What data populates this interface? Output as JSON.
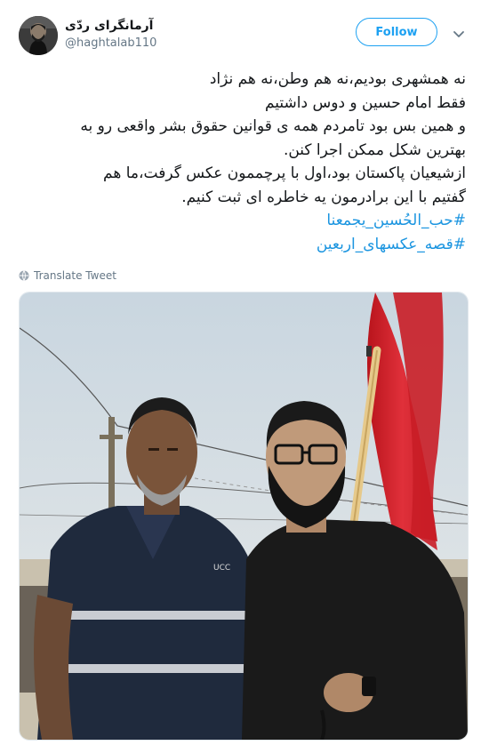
{
  "user": {
    "display_name": "آرمانگرای ردّی",
    "handle": "@haghtalab110",
    "avatar_icon": "avatar-photo"
  },
  "follow_button": {
    "label": "Follow"
  },
  "menu_icon": "chevron-down-icon",
  "tweet": {
    "lines": [
      "نه همشهری بودیم،نه هم وطن،نه هم نژاد",
      "فقط امام حسین و دوس داشتیم",
      "و همین بس بود تامردم همه ی قوانین حقوق بشر واقعی رو به",
      "بهترین شکل ممکن اجرا کنن.",
      "ازشیعیان پاکستان بود،اول با پرچممون عکس گرفت،ما هم",
      "گفتیم با این برادرمون یه خاطره ای ثبت کنیم."
    ],
    "hashtags": [
      "#حب_الحُسین_یجمعنا",
      "#قصه_عکسهای_اربعین"
    ]
  },
  "translate": {
    "label": "Translate Tweet",
    "icon": "globe-icon"
  },
  "photo": {
    "description_icon": "tweet-photo",
    "shirt_logo": "UCC"
  },
  "colors": {
    "link": "#1b95e0",
    "follow": "#1da1f2",
    "muted": "#657786",
    "flag": "#d9262e"
  }
}
